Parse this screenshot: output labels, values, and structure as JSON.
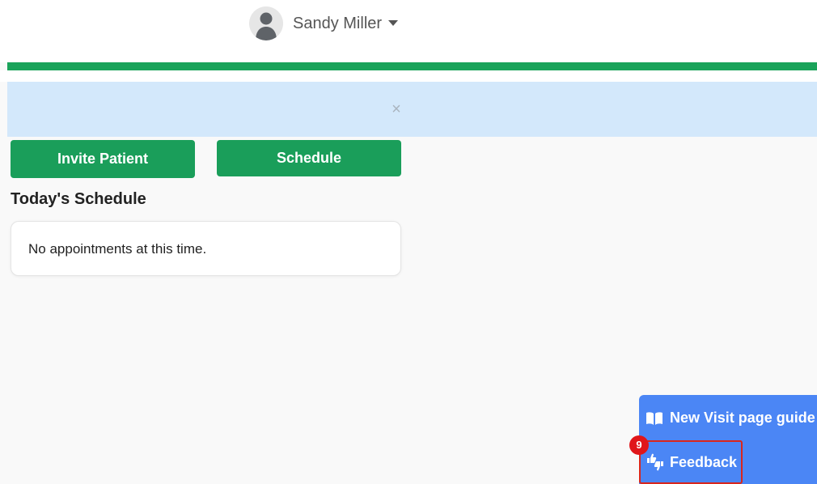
{
  "header": {
    "user_name": "Sandy Miller",
    "avatar_icon": "user-avatar-icon",
    "caret_icon": "caret-down-icon"
  },
  "alert": {
    "close_label": "×"
  },
  "actions": {
    "invite_label": "Invite Patient",
    "schedule_label": "Schedule"
  },
  "schedule": {
    "title": "Today's Schedule",
    "empty_message": "No appointments at this time."
  },
  "help": {
    "guide_label": "New Visit page guide",
    "guide_icon": "book-icon",
    "feedback_label": "Feedback",
    "feedback_icon": "thumbs-up-down-icon",
    "badge_count": "9"
  },
  "colors": {
    "brand_green": "#1aa35a",
    "alert_bg": "#d3e8fb",
    "help_blue": "#4b86f5",
    "highlight_red": "#d9261c"
  }
}
